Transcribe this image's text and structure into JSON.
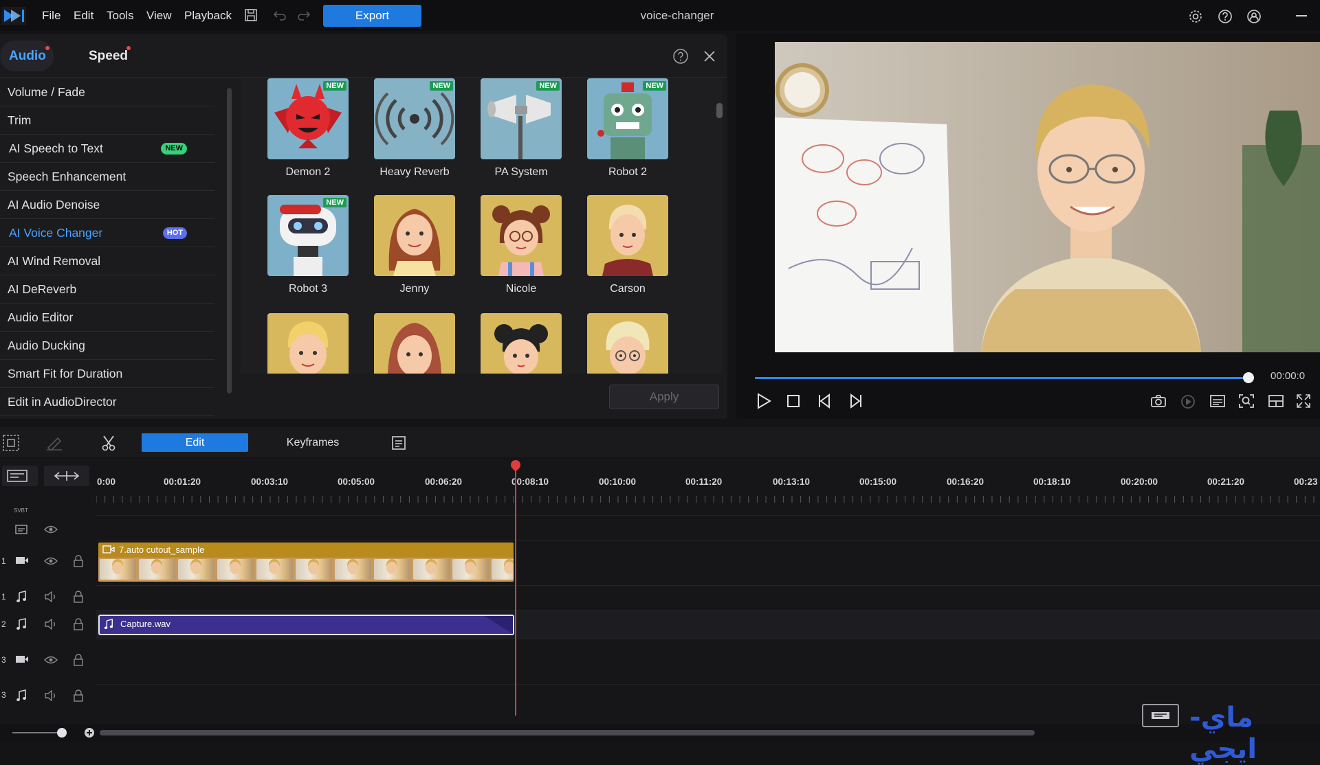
{
  "app": {
    "title": "voice-changer",
    "menu": [
      "File",
      "Edit",
      "Tools",
      "View",
      "Playback"
    ],
    "export_label": "Export"
  },
  "panel": {
    "tabs": [
      "Audio",
      "Speed"
    ],
    "menu_items": [
      {
        "label": "Volume / Fade",
        "badge": ""
      },
      {
        "label": "Trim",
        "badge": ""
      },
      {
        "label": "AI Speech to Text",
        "badge": "NEW"
      },
      {
        "label": "Speech Enhancement",
        "badge": ""
      },
      {
        "label": "AI Audio Denoise",
        "badge": ""
      },
      {
        "label": "AI Voice Changer",
        "badge": "HOT"
      },
      {
        "label": "AI Wind Removal",
        "badge": ""
      },
      {
        "label": "AI DeReverb",
        "badge": ""
      },
      {
        "label": "Audio Editor",
        "badge": ""
      },
      {
        "label": "Audio Ducking",
        "badge": ""
      },
      {
        "label": "Smart Fit for Duration",
        "badge": ""
      },
      {
        "label": "Edit in AudioDirector",
        "badge": ""
      }
    ],
    "voices": [
      {
        "label": "Demon 2",
        "tag": "NEW"
      },
      {
        "label": "Heavy Reverb",
        "tag": "NEW"
      },
      {
        "label": "PA System",
        "tag": "NEW"
      },
      {
        "label": "Robot 2",
        "tag": "NEW"
      },
      {
        "label": "Robot 3",
        "tag": "NEW"
      },
      {
        "label": "Jenny",
        "tag": ""
      },
      {
        "label": "Nicole",
        "tag": ""
      },
      {
        "label": "Carson",
        "tag": ""
      },
      {
        "label": "",
        "tag": ""
      },
      {
        "label": "",
        "tag": ""
      },
      {
        "label": "",
        "tag": ""
      },
      {
        "label": "",
        "tag": ""
      }
    ],
    "apply_label": "Apply"
  },
  "preview": {
    "timecode": "00:00:0",
    "progress": 1.0
  },
  "edit_toolbar": {
    "edit_label": "Edit",
    "keyframes_label": "Keyframes"
  },
  "timeline": {
    "ticks": [
      "0:00",
      "00:01:20",
      "00:03:10",
      "00:05:00",
      "00:06:20",
      "00:08:10",
      "00:10:00",
      "00:11:20",
      "00:13:10",
      "00:15:00",
      "00:16:20",
      "00:18:10",
      "00:20:00",
      "00:21:20",
      "00:23"
    ],
    "subtitle_track_label": "SVBT",
    "track_numbers": [
      "1",
      "1",
      "2",
      "3",
      "3"
    ],
    "video_clip": "7.auto cutout_sample",
    "audio_clip": "Capture.wav"
  },
  "watermark": "ماي-ايجي",
  "colors": {
    "accent": "#1f7ae0",
    "active_item": "#4aa3ff",
    "new_badge": "#36d27a",
    "hot_badge": "#5b6ff0",
    "playhead": "#e23b3b",
    "video_clip": "#b98a1c",
    "audio_clip": "#3b2f8f"
  }
}
